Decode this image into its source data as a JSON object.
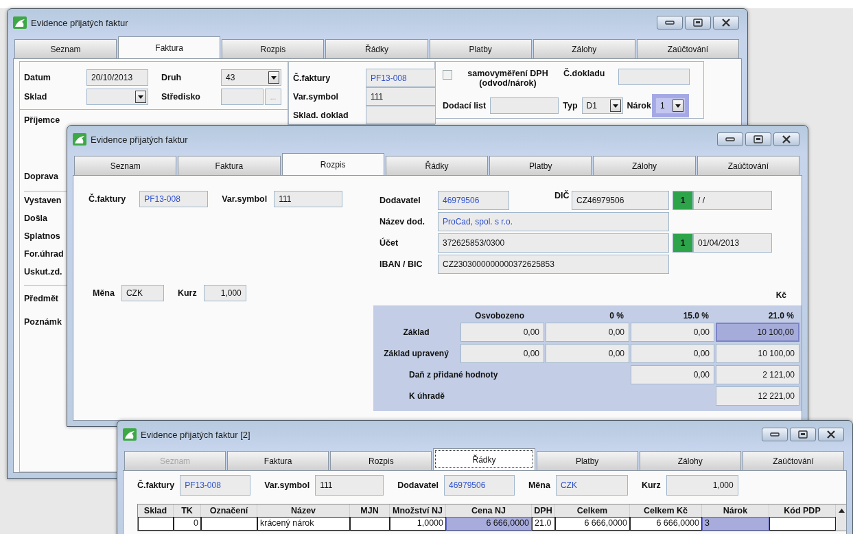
{
  "back_window": {
    "title": "Evidence přijatých faktur",
    "tabs": [
      {
        "label": "Seznam",
        "selected": false
      },
      {
        "label": "Faktura",
        "selected": true
      },
      {
        "label": "Rozpis",
        "selected": false
      },
      {
        "label": "Řádky",
        "selected": false
      },
      {
        "label": "Platby",
        "selected": false
      },
      {
        "label": "Zálohy",
        "selected": false
      },
      {
        "label": "Zaúčtování",
        "selected": false
      }
    ],
    "datum": {
      "label": "Datum",
      "value": "20/10/2013"
    },
    "druh": {
      "label": "Druh",
      "value": "43"
    },
    "sklad": {
      "label": "Sklad"
    },
    "stredisko": {
      "label": "Středisko",
      "button": "..."
    },
    "cislo_faktury": {
      "label": "Č.faktury",
      "value": "PF13-008",
      "accent": true
    },
    "var_symbol": {
      "label": "Var.symbol",
      "value": "111",
      "accent": false
    },
    "sklad_doklad": {
      "label": "Sklad. doklad"
    },
    "samovymereni": {
      "label_lines": [
        "samovyměření DPH",
        "(odvod/nárok)"
      ],
      "checked": false
    },
    "cislo_dokladu": {
      "label": "Č.dokladu"
    },
    "dodaci_list": {
      "label": "Dodací list"
    },
    "typ": {
      "label": "Typ",
      "value": "D1"
    },
    "narok": {
      "label": "Nárok",
      "value": "1",
      "highlighted": true
    },
    "label_groups": [
      [
        "Příjemce",
        "Doprava"
      ],
      [
        "Vystaven",
        "Došla",
        "Splatnos",
        "For.úhrad",
        "Uskut.zd."
      ],
      [
        "Předmět",
        "Poznámk"
      ]
    ]
  },
  "middle_window": {
    "title": "Evidence přijatých faktur",
    "tabs": [
      {
        "label": "Seznam",
        "selected": false
      },
      {
        "label": "Faktura",
        "selected": false
      },
      {
        "label": "Rozpis",
        "selected": true
      },
      {
        "label": "Řádky",
        "selected": false
      },
      {
        "label": "Platby",
        "selected": false
      },
      {
        "label": "Zálohy",
        "selected": false
      },
      {
        "label": "Zaúčtování",
        "selected": false
      }
    ],
    "cislo_faktury": {
      "label": "Č.faktury",
      "value": "PF13-008",
      "accent": true
    },
    "var_symbol": {
      "label": "Var.symbol",
      "value": "111",
      "accent": false
    },
    "mena": {
      "label": "Měna",
      "value": "CZK",
      "accent": false
    },
    "kurz": {
      "label": "Kurz",
      "value": "1,000"
    },
    "dodavatel": {
      "label": "Dodavatel",
      "value": "46979506",
      "accent": true
    },
    "dic": {
      "label": "DIČ",
      "value": "CZ46979506",
      "badge": "1",
      "extra": "/ /"
    },
    "nazev": {
      "label": "Název dod.",
      "value": "ProCad, spol. s r.o.",
      "accent": true
    },
    "ucet": {
      "label": "Účet",
      "value": "372625853/0300",
      "badge": "1",
      "extra": "01/04/2013"
    },
    "iban": {
      "label": "IBAN / BIC",
      "value": "CZ2303000000000372625853"
    },
    "currency": "Kč",
    "vat": {
      "columns": [
        "Osvobozeno",
        "0 %",
        "15.0 %",
        "21.0 %"
      ],
      "rows": [
        {
          "kind": "base",
          "label": "Základ",
          "cells": [
            {
              "value": "0,00",
              "highlighted": false
            },
            {
              "value": "0,00",
              "highlighted": false
            },
            {
              "value": "0,00",
              "highlighted": false
            },
            {
              "value": "10 100,00",
              "highlighted": true
            }
          ]
        },
        {
          "kind": "base",
          "label": "Základ upravený",
          "cells": [
            {
              "value": "0,00",
              "highlighted": false
            },
            {
              "value": "0,00",
              "highlighted": false
            },
            {
              "value": "0,00",
              "highlighted": false
            },
            {
              "value": "10 100,00",
              "highlighted": false
            }
          ]
        },
        {
          "kind": "sum",
          "label": "Daň z přidané hodnoty",
          "cells": [
            {},
            {},
            {
              "value": "0,00",
              "highlighted": false
            },
            {
              "value": "2 121,00",
              "highlighted": false
            }
          ]
        },
        {
          "kind": "sum",
          "label": "K úhradě",
          "cells": [
            {},
            {},
            {},
            {
              "value": "12 221,00",
              "highlighted": false
            }
          ]
        }
      ]
    }
  },
  "front_window": {
    "title": "Evidence přijatých faktur [2]",
    "tabs": [
      {
        "label": "Seznam",
        "selected": false,
        "disabled": true
      },
      {
        "label": "Faktura",
        "selected": false,
        "disabled": false
      },
      {
        "label": "Rozpis",
        "selected": false,
        "disabled": false
      },
      {
        "label": "Řádky",
        "selected": true,
        "disabled": false
      },
      {
        "label": "Platby",
        "selected": false,
        "disabled": false
      },
      {
        "label": "Zálohy",
        "selected": false,
        "disabled": false
      },
      {
        "label": "Zaúčtování",
        "selected": false,
        "disabled": false
      }
    ],
    "cislo_faktury": {
      "label": "Č.faktury",
      "value": "PF13-008",
      "accent": true
    },
    "var_symbol": {
      "label": "Var.symbol",
      "value": "111",
      "accent": false
    },
    "dodavatel": {
      "label": "Dodavatel",
      "value": "46979506",
      "accent": true
    },
    "mena": {
      "label": "Měna",
      "value": "CZK",
      "accent": true
    },
    "kurz": {
      "label": "Kurz",
      "value": "1,000"
    },
    "table": {
      "columns": [
        "Sklad",
        "TK",
        "Označení",
        "Název",
        "MJN",
        "Množství NJ",
        "Cena NJ",
        "DPH",
        "Celkem",
        "Celkem Kč",
        "Nárok",
        "Kód PDP"
      ],
      "rows": [
        {
          "cells": [
            {
              "highlighted": false
            },
            {
              "text": "0",
              "highlighted": false
            },
            {
              "highlighted": false
            },
            {
              "text": "krácený nárok",
              "highlighted": false
            },
            {
              "highlighted": false
            },
            {
              "text": "1,0000",
              "highlighted": false
            },
            {
              "text": "6 666,0000",
              "highlighted": true
            },
            {
              "text": "21.0",
              "highlighted": false
            },
            {
              "text": "6 666,0000",
              "highlighted": false
            },
            {
              "text": "6 666,0000",
              "highlighted": false
            },
            {
              "text": "3",
              "highlighted": true
            },
            {
              "highlighted": false
            }
          ]
        }
      ]
    }
  }
}
